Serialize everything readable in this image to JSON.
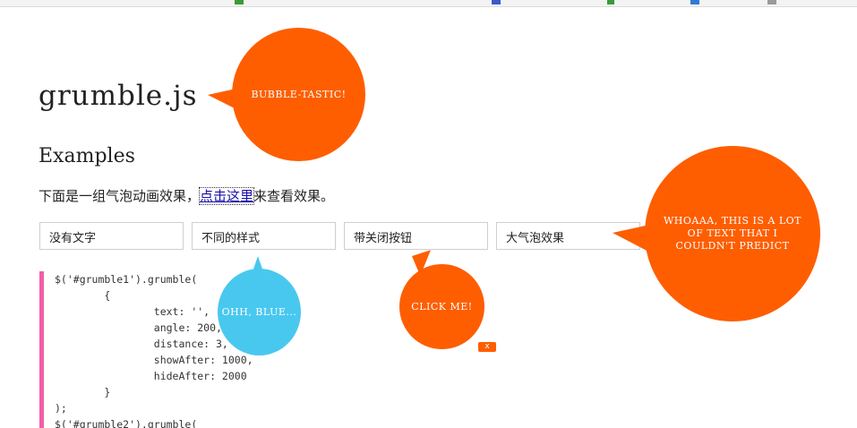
{
  "page": {
    "title": "grumble.js",
    "subtitle": "Examples",
    "intro_text": "下面是一组气泡动画效果，",
    "intro_link": "点击这里",
    "intro_tail": "来查看效果。"
  },
  "demo_buttons": [
    {
      "label": "没有文字"
    },
    {
      "label": "不同的样式"
    },
    {
      "label": "带关闭按钮"
    },
    {
      "label": "大气泡效果"
    }
  ],
  "bubbles": {
    "title_bubble": "BUBBLE-TASTIC!",
    "blue_bubble": "OHH, BLUE...",
    "click_bubble": "CLICK ME!",
    "close_label": "x",
    "big_bubble": "WHOAAA, THIS IS A LOT OF TEXT THAT I COULDN'T PREDICT"
  },
  "code_lines": [
    "$('#grumble1').grumble(",
    "        {",
    "                text: '',",
    "                angle: 200,",
    "                distance: 3,",
    "                showAfter: 1000,",
    "                hideAfter: 2000",
    "        }",
    ");",
    "$('#grumble2').grumble("
  ],
  "colors": {
    "bubble_orange": "#fe5e00",
    "bubble_blue": "#49c8ef",
    "code_border": "#f25ea8",
    "link": "#1a0dab"
  }
}
